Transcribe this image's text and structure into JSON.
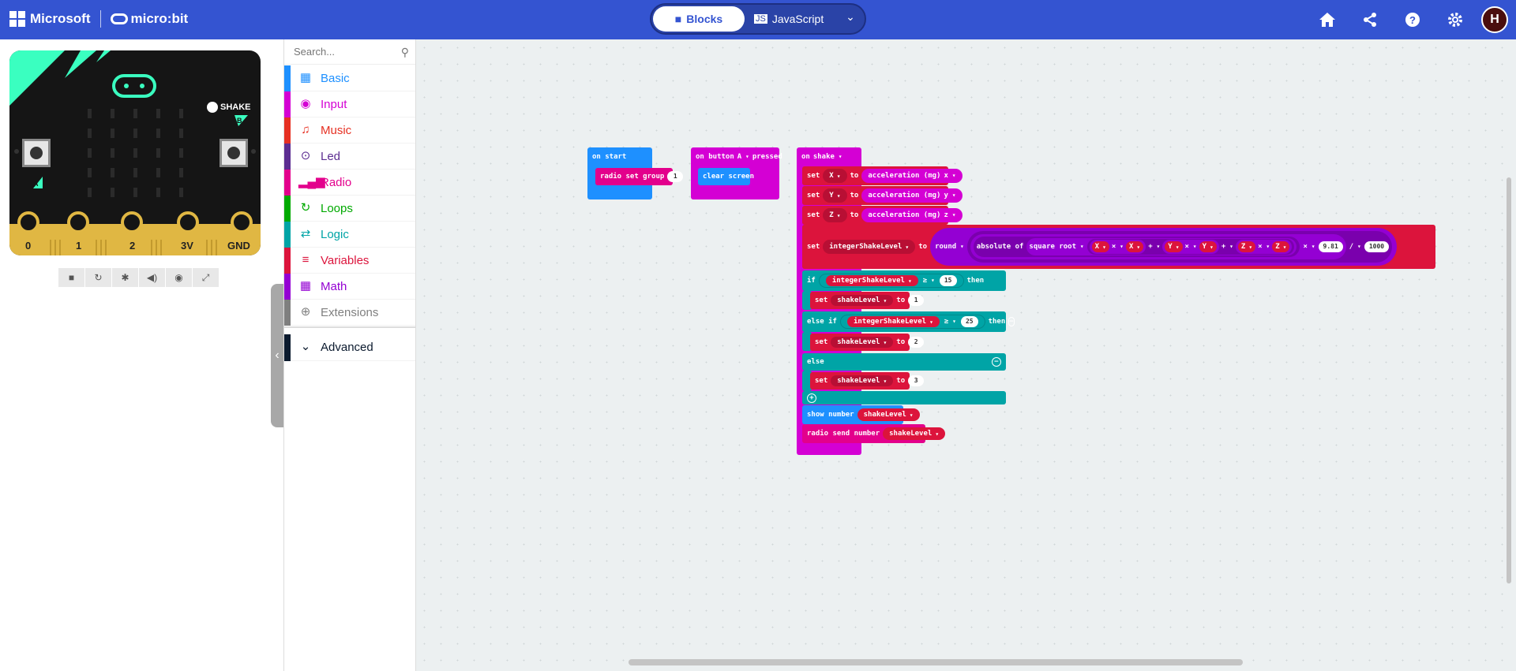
{
  "header": {
    "brand": "Microsoft",
    "product": "micro:bit",
    "tabs": {
      "blocks": "Blocks",
      "javascript": "JavaScript"
    },
    "avatar_initial": "H",
    "icons": [
      "home-icon",
      "share-icon",
      "help-icon",
      "settings-icon"
    ]
  },
  "simulator": {
    "pins": [
      "0",
      "1",
      "2",
      "3V",
      "GND"
    ],
    "button_a": "A",
    "button_b": "B",
    "shake_label": "SHAKE",
    "toolbar_icons": [
      "stop-icon",
      "restart-icon",
      "debug-icon",
      "mute-icon",
      "screenshot-icon",
      "fullscreen-icon"
    ]
  },
  "toolbox": {
    "search_placeholder": "Search...",
    "categories": [
      {
        "label": "Basic",
        "color": "#1e90ff",
        "icon": "grid-icon"
      },
      {
        "label": "Input",
        "color": "#d400d4",
        "icon": "input-icon"
      },
      {
        "label": "Music",
        "color": "#e63022",
        "icon": "headphones-icon"
      },
      {
        "label": "Led",
        "color": "#5c2d91",
        "icon": "toggle-icon"
      },
      {
        "label": "Radio",
        "color": "#e3008c",
        "icon": "signal-icon"
      },
      {
        "label": "Loops",
        "color": "#00aa00",
        "icon": "loop-icon"
      },
      {
        "label": "Logic",
        "color": "#00a4a6",
        "icon": "shuffle-icon"
      },
      {
        "label": "Variables",
        "color": "#dc143c",
        "icon": "list-icon"
      },
      {
        "label": "Math",
        "color": "#9400d3",
        "icon": "calculator-icon"
      },
      {
        "label": "Extensions",
        "color": "#7f7f7f",
        "icon": "plus-circle-icon"
      },
      {
        "label": "Advanced",
        "color": "#0b1a2e",
        "icon": "chevron-down-icon"
      }
    ]
  },
  "blocks": {
    "on_start": {
      "label": "on start",
      "radio_set_group": "radio set group",
      "group_value": "1"
    },
    "on_button": {
      "on_button": "on button",
      "button": "A",
      "pressed": "pressed",
      "clear_screen": "clear screen"
    },
    "on_shake": {
      "label": "on",
      "gesture": "shake",
      "set": "set",
      "to": "to",
      "vars": [
        "X",
        "Y",
        "Z"
      ],
      "accel": "acceleration (mg)",
      "axes": [
        "x",
        "y",
        "z"
      ],
      "integer_var": "integerShakeLevel",
      "round": "round",
      "abs": "absolute of",
      "sqrt": "square root",
      "times": "×",
      "plus": "+",
      "divide": "/",
      "gravity": "9.81",
      "scale": "1000",
      "if": "if",
      "then": "then",
      "else_if": "else if",
      "else": "else",
      "gte": "≥",
      "threshold1": "15",
      "threshold2": "25",
      "shake_var": "shakeLevel",
      "level1": "1",
      "level2": "2",
      "level3": "3",
      "show_number": "show number",
      "radio_send": "radio send number"
    }
  }
}
